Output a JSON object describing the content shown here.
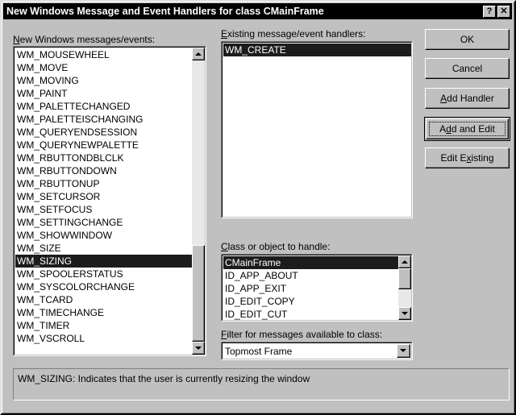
{
  "window": {
    "title": "New Windows Message and Event Handlers for class CMainFrame",
    "help_button": "?",
    "close_button": "✕"
  },
  "messages_list": {
    "label_prefix": "",
    "label_accel": "N",
    "label_rest": "ew Windows messages/events:",
    "items": [
      "WM_MOUSEWHEEL",
      "WM_MOVE",
      "WM_MOVING",
      "WM_PAINT",
      "WM_PALETTECHANGED",
      "WM_PALETTEISCHANGING",
      "WM_QUERYENDSESSION",
      "WM_QUERYNEWPALETTE",
      "WM_RBUTTONDBLCLK",
      "WM_RBUTTONDOWN",
      "WM_RBUTTONUP",
      "WM_SETCURSOR",
      "WM_SETFOCUS",
      "WM_SETTINGCHANGE",
      "WM_SHOWWINDOW",
      "WM_SIZE",
      "WM_SIZING",
      "WM_SPOOLERSTATUS",
      "WM_SYSCOLORCHANGE",
      "WM_TCARD",
      "WM_TIMECHANGE",
      "WM_TIMER",
      "WM_VSCROLL"
    ],
    "selected": "WM_SIZING",
    "selected_index": 16,
    "scroll_up_icon": "arrow-up-icon",
    "scroll_down_icon": "arrow-down-icon"
  },
  "handlers_list": {
    "label_accel": "E",
    "label_rest": "xisting message/event handlers:",
    "items": [
      "WM_CREATE"
    ],
    "selected": "WM_CREATE",
    "selected_index": 0
  },
  "class_list": {
    "label_accel": "C",
    "label_rest": "lass or object to handle:",
    "items": [
      "CMainFrame",
      "ID_APP_ABOUT",
      "ID_APP_EXIT",
      "ID_EDIT_COPY",
      "ID_EDIT_CUT"
    ],
    "selected": "CMainFrame",
    "selected_index": 0,
    "scroll_up_icon": "arrow-up-icon",
    "scroll_down_icon": "arrow-down-icon"
  },
  "filter_combo": {
    "label_accel": "F",
    "label_rest": "ilter for messages available to class:",
    "value": "Topmost Frame",
    "dropdown_icon": "chevron-down-icon"
  },
  "buttons": {
    "ok": {
      "label": "OK"
    },
    "cancel": {
      "label": "Cancel"
    },
    "add_handler": {
      "accel": "A",
      "rest": "dd Handler",
      "pre": ""
    },
    "add_and_edit": {
      "pre": "A",
      "accel": "d",
      "rest": "d and Edit"
    },
    "edit_existing": {
      "pre": "Edit E",
      "accel": "x",
      "rest": "isting"
    }
  },
  "status": {
    "text": "WM_SIZING:  Indicates that the user is currently resizing the window"
  },
  "colors": {
    "face": "#c0c0c0",
    "titlebar": "#000000",
    "selection": "#1c1c1c",
    "white": "#ffffff",
    "shadow": "#808080"
  }
}
